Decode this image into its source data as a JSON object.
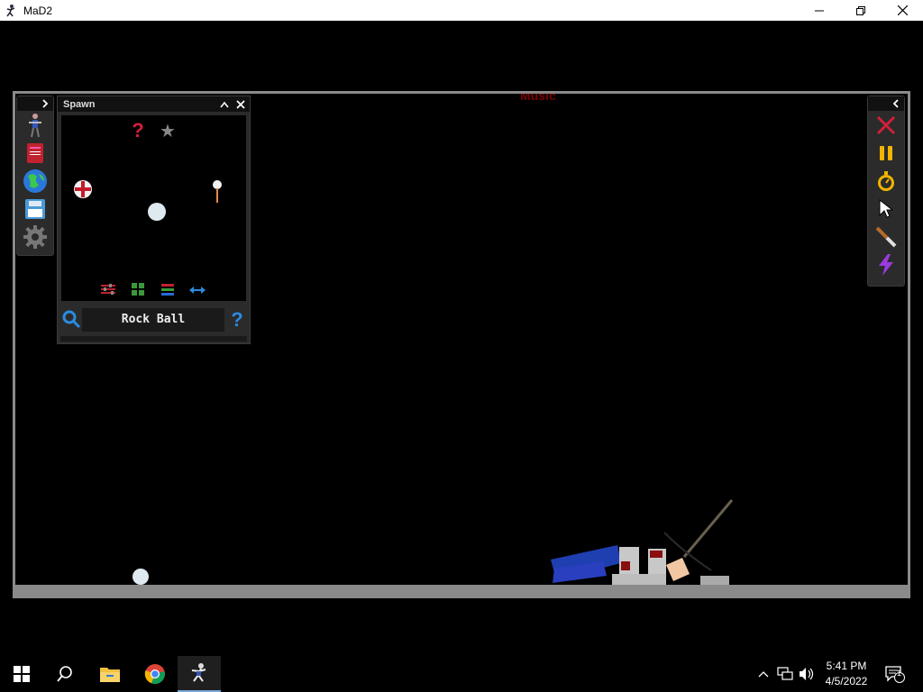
{
  "window": {
    "title": "MaD2",
    "controls": [
      "minimize",
      "restore",
      "close"
    ]
  },
  "stage": {
    "title_partial": "Music"
  },
  "left_toolbar": {
    "items": [
      {
        "name": "ragdoll-icon"
      },
      {
        "name": "book-icon"
      },
      {
        "name": "globe-icon"
      },
      {
        "name": "save-icon"
      },
      {
        "name": "gear-icon"
      }
    ]
  },
  "spawn_panel": {
    "title": "Spawn",
    "items": [
      {
        "name": "random-question-icon",
        "glyph": "?"
      },
      {
        "name": "favorite-star-icon",
        "glyph": "★"
      },
      {
        "name": "medical-ball-icon"
      },
      {
        "name": "pin-icon"
      },
      {
        "name": "rock-ball-icon"
      }
    ],
    "footer_icons": [
      "sliders-icon",
      "grid-view-icon",
      "list-view-icon",
      "swap-arrows-icon"
    ],
    "search_value": "Rock Ball",
    "help_glyph": "?"
  },
  "right_toolbar": {
    "items": [
      {
        "name": "clear-x-icon"
      },
      {
        "name": "pause-icon"
      },
      {
        "name": "stopwatch-icon"
      },
      {
        "name": "cursor-icon"
      },
      {
        "name": "knife-icon"
      },
      {
        "name": "lightning-icon"
      }
    ]
  },
  "taskbar": {
    "apps": [
      "windows-start-icon",
      "search-icon",
      "file-explorer-icon",
      "chrome-icon",
      "mad2-app-icon"
    ],
    "tray": [
      "chevron-up-icon",
      "network-icon",
      "volume-icon",
      "notification-icon"
    ],
    "time": "5:41 PM",
    "date": "4/5/2022",
    "notification_count": "1"
  },
  "colors": {
    "accent_red": "#d1203a",
    "accent_blue": "#2a8be0",
    "panel_bg": "#2b2b2b",
    "frame_gray": "#8a8a8a"
  }
}
